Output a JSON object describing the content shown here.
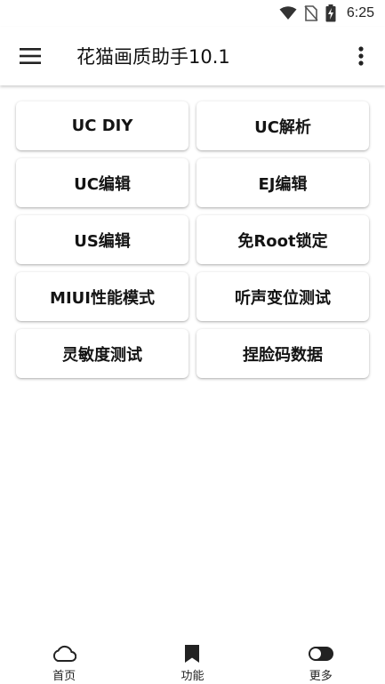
{
  "status_bar": {
    "time": "6:25",
    "icons": [
      "wifi-icon",
      "no-sim-icon",
      "battery-charging-icon"
    ]
  },
  "app_bar": {
    "title": "花猫画质助手10.1",
    "menu_icon": "hamburger-menu-icon",
    "overflow_icon": "more-vertical-icon"
  },
  "buttons": [
    {
      "label": "UC DIY"
    },
    {
      "label": "UC解析"
    },
    {
      "label": "UC编辑"
    },
    {
      "label": "EJ编辑"
    },
    {
      "label": "US编辑"
    },
    {
      "label": "免Root锁定"
    },
    {
      "label": "MIUI性能模式"
    },
    {
      "label": "听声变位测试"
    },
    {
      "label": "灵敏度测试"
    },
    {
      "label": "捏脸码数据"
    }
  ],
  "bottom_nav": {
    "items": [
      {
        "label": "首页",
        "icon": "cloud-icon"
      },
      {
        "label": "功能",
        "icon": "bookmark-icon"
      },
      {
        "label": "更多",
        "icon": "toggle-icon"
      }
    ]
  },
  "colors": {
    "background": "#ffffff",
    "text": "#141414"
  }
}
